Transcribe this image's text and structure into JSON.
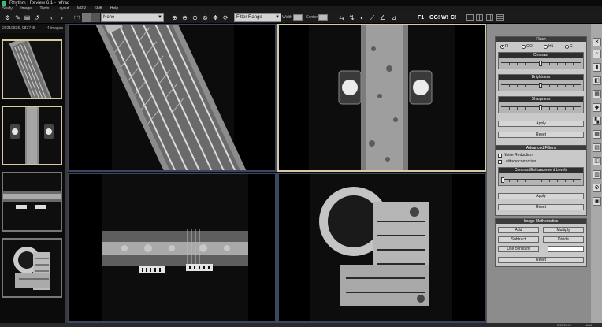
{
  "window": {
    "title": "Rhythm | Review 6.1 - refrad"
  },
  "menu": [
    "Study",
    "Image",
    "Tools",
    "Layout",
    "MPR",
    "Shift",
    "Help"
  ],
  "toolbar": {
    "annotation_select": "None",
    "filter_select": "Filter Range",
    "width_label": "Width",
    "center_label": "Center",
    "f1": "F1",
    "og": "OG!",
    "w": "W!",
    "c": "C!"
  },
  "thumbnails": {
    "study_id": "29210835, 983748",
    "count": "4 images"
  },
  "flash": {
    "title": "Flash",
    "radios": [
      "Fl",
      "OO",
      "H1",
      "C"
    ],
    "contrast": "Contrast",
    "brightness": "Brightness",
    "sharpness": "Sharpness",
    "apply": "Apply",
    "reset": "Reset"
  },
  "advanced": {
    "title": "Advanced Filters",
    "noise": "Noise Reduction",
    "latitude": "Latitude correction",
    "levels": "Contrast Enhancement Levels",
    "apply": "Apply",
    "reset": "Reset"
  },
  "math": {
    "title": "Image Mathematics",
    "add": "Add",
    "multiply": "Multiply",
    "subtract": "Subtract",
    "divide": "Divide",
    "use_constant": "Use constant",
    "reset": "Reset"
  },
  "status": {
    "text": "2/25/2005",
    "mode": "NUM"
  }
}
